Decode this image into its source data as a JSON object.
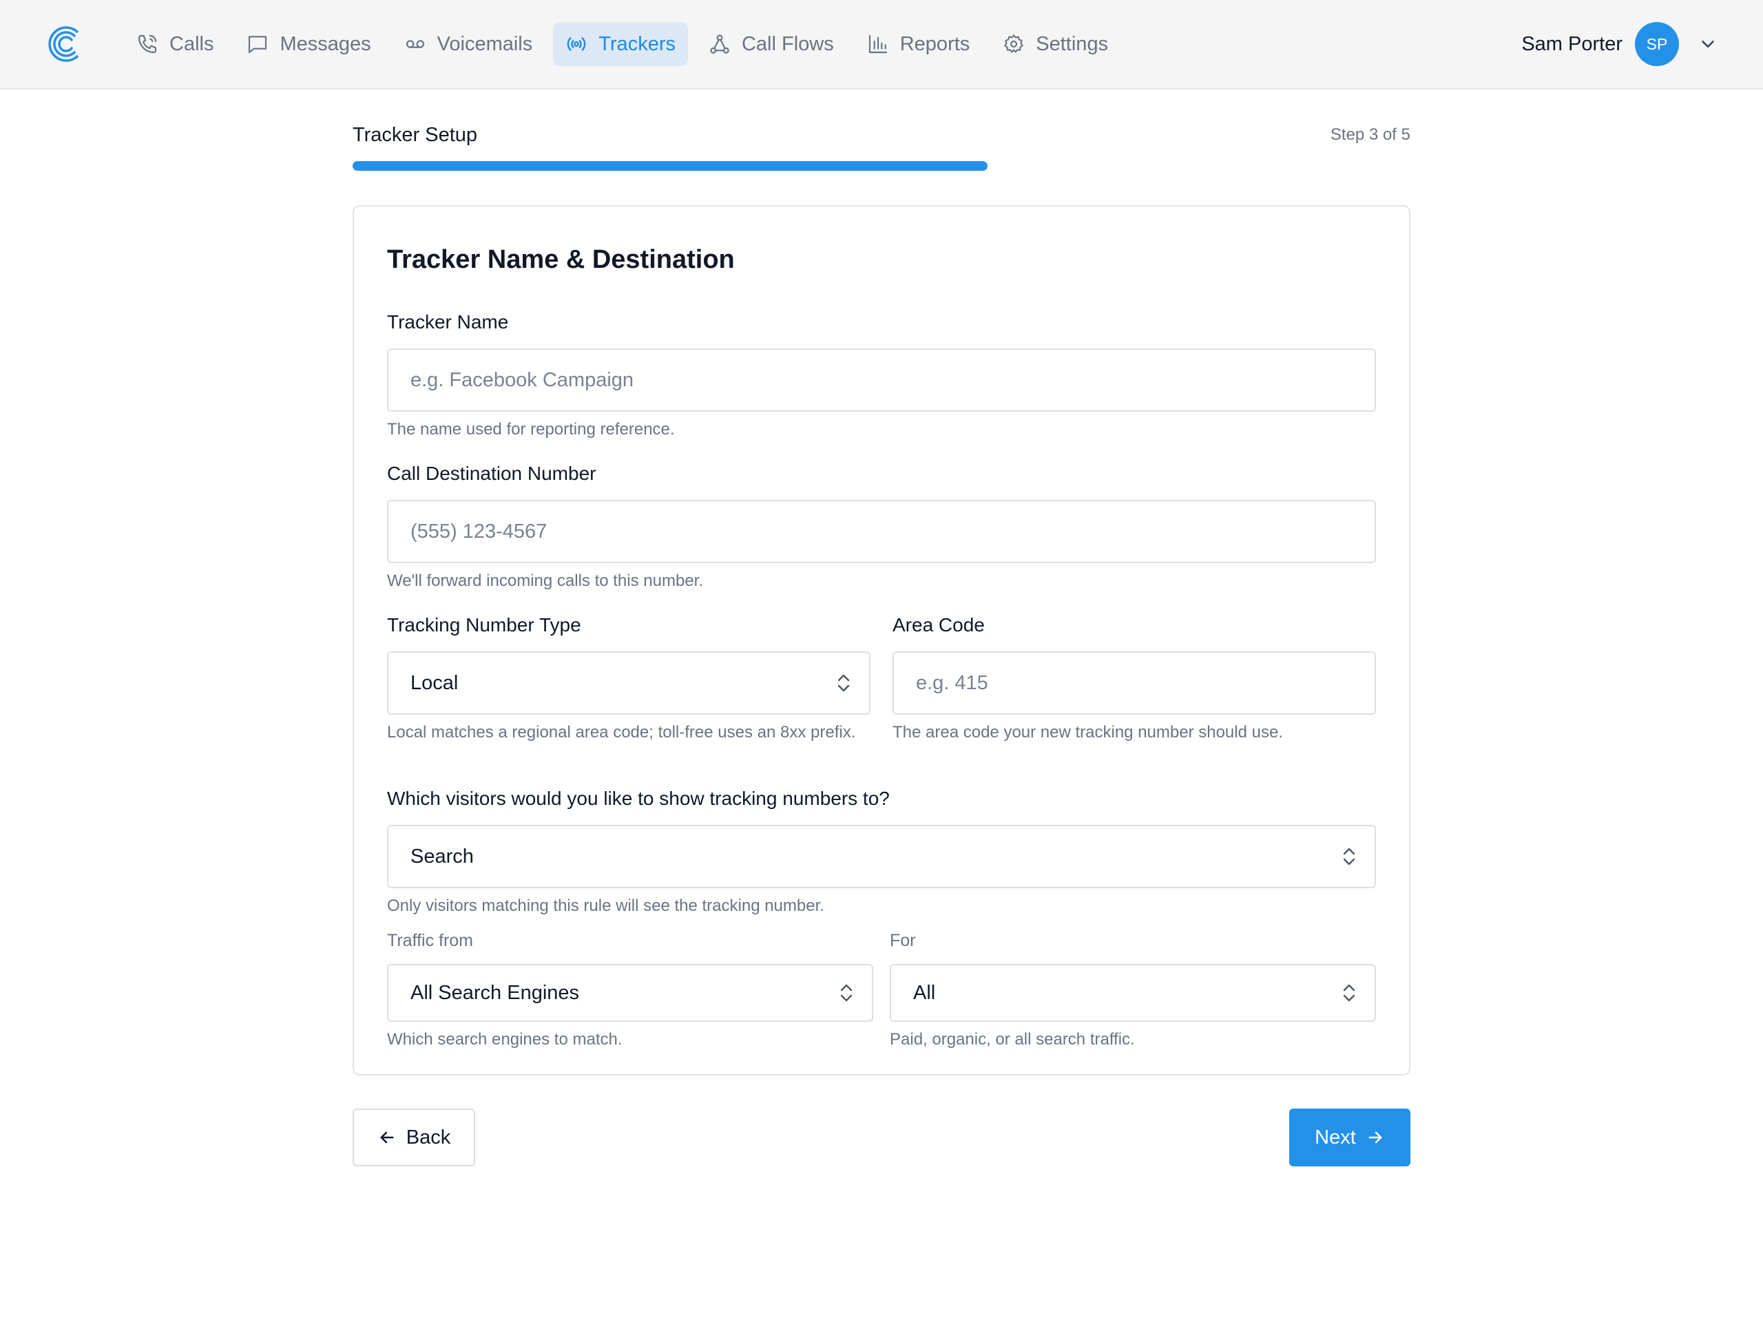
{
  "nav": {
    "items": [
      {
        "label": "Calls",
        "icon": "phone-icon"
      },
      {
        "label": "Messages",
        "icon": "message-icon"
      },
      {
        "label": "Voicemails",
        "icon": "voicemail-icon"
      },
      {
        "label": "Trackers",
        "icon": "tracker-icon",
        "active": true
      },
      {
        "label": "Call Flows",
        "icon": "call-flows-icon"
      },
      {
        "label": "Reports",
        "icon": "reports-icon"
      },
      {
        "label": "Settings",
        "icon": "gear-icon"
      }
    ],
    "user": {
      "name": "Sam Porter",
      "initials": "SP"
    }
  },
  "wizard": {
    "title": "Tracker Setup",
    "step": "Step 3 of 5",
    "progress_fraction": 0.6
  },
  "form": {
    "title": "Tracker Name & Destination",
    "tracker_name": {
      "label": "Tracker Name",
      "placeholder": "e.g. Facebook Campaign",
      "value": "",
      "help": "The name used for reporting reference."
    },
    "destination": {
      "label": "Call Destination Number",
      "placeholder": "(555) 123-4567",
      "value": "",
      "help": "We'll forward incoming calls to this number."
    },
    "number_type": {
      "label": "Tracking Number Type",
      "value": "Local",
      "help": "Local matches a regional area code; toll-free uses an 8xx prefix."
    },
    "area_code": {
      "label": "Area Code",
      "placeholder": "e.g. 415",
      "value": "",
      "help": "The area code your new tracking number should use."
    },
    "visitors": {
      "label": "Which visitors would you like to show tracking numbers to?",
      "value": "Search",
      "help": "Only visitors matching this rule will see the tracking number."
    },
    "traffic_from": {
      "label": "Traffic from",
      "value": "All Search Engines",
      "help": "Which search engines to match."
    },
    "for": {
      "label": "For",
      "value": "All",
      "help": "Paid, organic, or all search traffic."
    }
  },
  "actions": {
    "back_label": "Back",
    "next_label": "Next"
  },
  "colors": {
    "accent": "#2491e9",
    "nav_active_bg": "#dce8f6",
    "nav_bg": "#f5f5f5"
  }
}
